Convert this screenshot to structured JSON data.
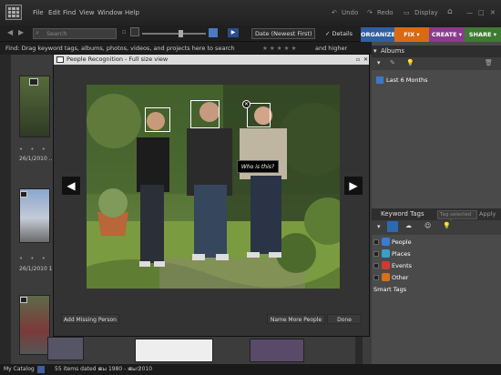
{
  "menu": [
    "File",
    "Edit",
    "Find",
    "View",
    "Window",
    "Help"
  ],
  "toolbar_right": {
    "undo": "Undo",
    "redo": "Redo",
    "display": "Display"
  },
  "search": {
    "placeholder": "Search"
  },
  "sort": {
    "value": "Date (Newest First)"
  },
  "details": {
    "label": "Details"
  },
  "modes": [
    {
      "label": "ORGANIZE",
      "color": "#2f5f9e"
    },
    {
      "label": "FIX",
      "color": "#d86a14"
    },
    {
      "label": "CREATE",
      "color": "#8a3c8c"
    },
    {
      "label": "SHARE",
      "color": "#3f7a34"
    }
  ],
  "findbar": {
    "text": "Find: Drag keyword tags, albums, photos, videos, and projects here to search",
    "extra": "and higher"
  },
  "browser": {
    "date1": "26/1/2010 ...",
    "date2": "26/1/2010 17:..."
  },
  "albums": {
    "title": "Albums",
    "item": "Last 6 Months"
  },
  "keywords": {
    "title": "Keyword Tags",
    "search_placeholder": "Tag selected media",
    "apply": "Apply",
    "items": [
      {
        "label": "People",
        "color": "#3a7bd5"
      },
      {
        "label": "Places",
        "color": "#3aa0c8"
      },
      {
        "label": "Events",
        "color": "#d03a2e"
      },
      {
        "label": "Other",
        "color": "#d8701a"
      }
    ],
    "smart": "Smart Tags"
  },
  "dialog": {
    "title": "People Recognition - Full size view",
    "who": "Who is this?",
    "add_missing": "Add Missing Person",
    "name_more": "Name More People",
    "done": "Done"
  },
  "status": {
    "catalog": "My Catalog",
    "items": "55 items dated ѭы 1980 - ѭы 2010"
  }
}
